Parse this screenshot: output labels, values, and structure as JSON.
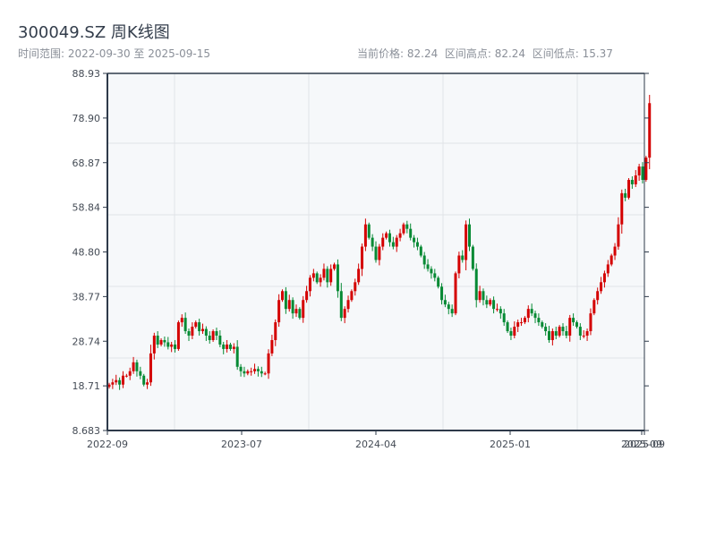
{
  "header": {
    "title": "300049.SZ 周K线图",
    "range_label": "时间范围: 2022-09-30 至 2025-09-15",
    "current_price": "当前价格: 82.24",
    "high": "区间高点: 82.24",
    "low": "区间低点: 15.37"
  },
  "chart_data": {
    "type": "candlestick",
    "title": "300049.SZ 周K线图",
    "ylim": [
      8.683,
      88.93
    ],
    "y_ticks": [
      "88.93",
      "78.90",
      "68.87",
      "58.84",
      "48.80",
      "38.77",
      "28.74",
      "18.71",
      "8.683"
    ],
    "x_ticks": [
      "2022-09",
      "2023-07",
      "2024-04",
      "2025-01",
      "2025-09",
      "2025-09"
    ],
    "x_tick_weeks": [
      0,
      40,
      80,
      120,
      154,
      155
    ],
    "up_color": "#d40000",
    "down_color": "#068a34",
    "weeks": 155,
    "close": [
      19,
      19.5,
      20,
      19,
      21,
      21,
      22,
      24,
      22,
      21,
      19,
      19.5,
      26,
      30,
      28,
      29,
      28.5,
      27.5,
      28,
      27,
      33,
      34,
      31,
      30,
      32,
      33,
      31,
      31.5,
      30,
      29,
      31,
      30,
      28,
      27,
      28,
      27,
      27.5,
      23,
      22,
      21.5,
      22,
      22,
      22.5,
      22,
      21.5,
      21.5,
      26,
      29,
      33,
      38,
      40,
      36,
      38,
      35,
      36,
      34,
      38,
      40,
      43,
      44,
      42,
      43,
      45,
      42,
      45,
      46,
      40,
      34,
      36,
      38,
      40,
      42,
      45,
      50,
      55,
      52,
      50,
      47,
      50,
      52,
      53,
      51,
      50,
      52,
      53,
      55,
      54,
      52,
      51,
      50,
      48,
      46,
      45,
      44,
      43,
      41,
      38,
      37,
      36,
      35,
      44,
      48,
      47,
      55,
      50,
      45,
      38,
      40,
      38,
      37,
      38,
      36,
      36,
      35,
      33,
      31,
      30,
      32,
      33,
      33,
      34,
      36,
      35,
      34,
      33,
      32,
      31,
      29,
      31,
      30,
      32,
      31,
      30,
      34,
      33,
      32,
      30,
      30,
      31,
      35,
      38,
      40,
      42,
      44,
      46,
      48,
      50,
      55,
      62,
      61,
      65,
      64,
      66,
      68,
      65,
      70,
      82.24
    ]
  }
}
